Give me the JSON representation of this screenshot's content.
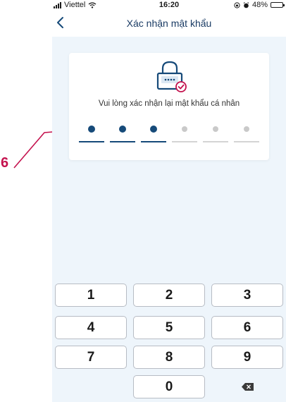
{
  "annotation": {
    "label": "6",
    "color": "#c4124e"
  },
  "status_bar": {
    "carrier": "Viettel",
    "time": "16:20",
    "battery": "48%",
    "battery_level": 0.48
  },
  "nav": {
    "title": "Xác nhận mật khẩu",
    "back_icon": "chevron-left-icon"
  },
  "card": {
    "icon": "lock-check-icon",
    "prompt": "Vui lòng xác nhận lại mật khẩu cá nhân",
    "pin_length": 6,
    "pin_filled": 3
  },
  "keypad": {
    "keys": [
      "1",
      "2",
      "3",
      "4",
      "5",
      "6",
      "7",
      "8",
      "9",
      "0"
    ],
    "backspace_icon": "backspace-icon"
  },
  "colors": {
    "accent": "#164a79",
    "background": "#eef5fb",
    "badge": "#c4124e"
  }
}
